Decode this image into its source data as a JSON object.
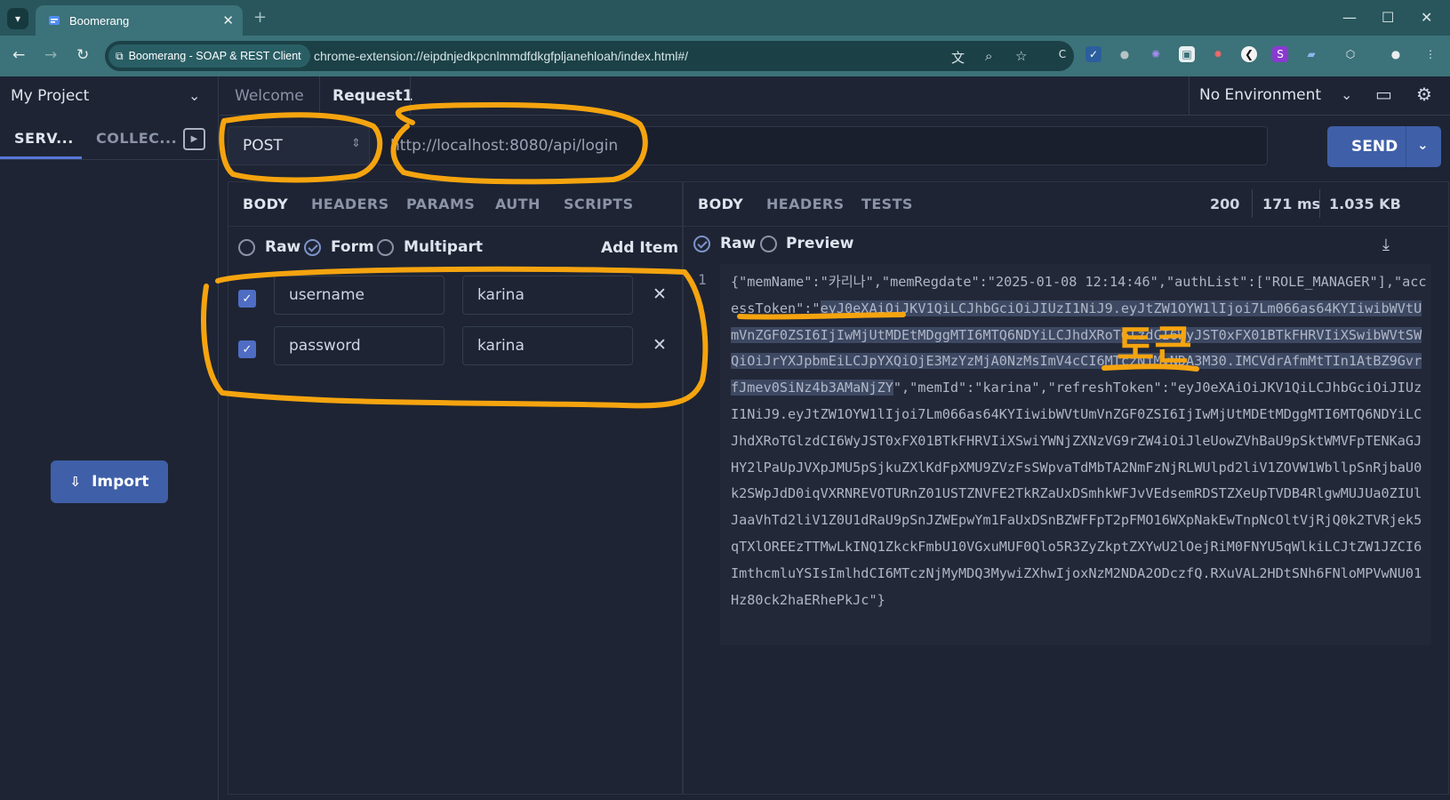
{
  "browser": {
    "tab_title": "Boomerang",
    "site_chip": "Boomerang - SOAP & REST Client",
    "url": "chrome-extension://eipdnjedkpcnlmmdfdkgfpljanehloah/index.html#/"
  },
  "sidebar": {
    "project": "My Project",
    "tabs": [
      "SERV...",
      "COLLEC..."
    ],
    "import_label": "Import"
  },
  "request_tabs": [
    "Welcome",
    "Request1"
  ],
  "environment": "No Environment",
  "request": {
    "method": "POST",
    "url": "http://localhost:8080/api/login",
    "send_label": "SEND",
    "tabs": [
      "BODY",
      "HEADERS",
      "PARAMS",
      "AUTH",
      "SCRIPTS"
    ],
    "body_modes": [
      "Raw",
      "Form",
      "Multipart"
    ],
    "selected_mode": "Form",
    "add_item_label": "Add Item",
    "form_rows": [
      {
        "checked": true,
        "key": "username",
        "value": "karina"
      },
      {
        "checked": true,
        "key": "password",
        "value": "karina"
      }
    ]
  },
  "response": {
    "tabs": [
      "BODY",
      "HEADERS",
      "TESTS"
    ],
    "view_modes": [
      "Raw",
      "Preview"
    ],
    "status": "200",
    "time": "171 ms",
    "size": "1.035 KB",
    "line_number": "1",
    "body_pre": "{\"memName\":\"카리나\",\"memRegdate\":\"2025-01-08 12:14:46\",\"authList\":[\"ROLE_MANAGER\"],\"accessToken\":\"",
    "body_selected": "eyJ0eXAiOiJKV1QiLCJhbGciOiJIUzI1NiJ9.eyJtZW1OYW1lIjoi7Lm066as64KYIiwibWVtUmVnZGF0ZSI6IjIwMjUtMDEtMDggMTI6MTQ6NDYiLCJhdXRoTGlzdCI6WyJST0xFX01BTkFHRVIiXSwibWVtSWQiOiJrYXJpbmEiLCJpYXQiOjE3MzYzMjA0NzMsImV4cCI6MTczNjMyNDA3M30.IMCVdrAfmMtTIn1AtBZ9GvrfJmev0SiNz4b3AMaNjZY",
    "body_post": "\",\"memId\":\"karina\",\"refreshToken\":\"eyJ0eXAiOiJKV1QiLCJhbGciOiJIUzI1NiJ9.eyJtZW1OYW1lIjoi7Lm066as64KYIiwibWVtUmVnZGF0ZSI6IjIwMjUtMDEtMDggMTI6MTQ6NDYiLCJhdXRoTGlzdCI6WyJST0xFX01BTkFHRVIiXSwiYWNjZXNzVG9rZW4iOiJleUowZVhBaU9pSktWMVFpTENKaGJHY2lPaUpJVXpJMU5pSjkuZXlKdFpXMU9ZVzFsSWpvaTdMbTA2NmFzNjRLWUlpd2liV1ZOVW1WbllpSnRjbaU0k2SWpJdD0iqVXRNREVOTURnZ01USTZNVFE2TkRZaUxDSmhkWFJvVEdsemRDSTZXeUpTVDB4RlgwMUJUa0ZIUlJaaVhTd2liV1Z0U1dRaU9pSnJZWEpwYm1FaUxDSnBZWFFpT2pFMO16WXpNakEwTnpNcOltVjRjQ0k2TVRjek5qTXlOREEzTTMwLkINQ1ZkckFmbU10VGxuMUF0Qlo5R3ZyZkptZXYwU2lOejRiM0FNYU5qWlkiLCJtZW1JZCI6ImthcmluYSIsImlhdCI6MTczNjMyMDQ3MywiZXhwIjoxNzM2NDA2ODczfQ.RXuVAL2HDtSNh6FNloMPVwNU01Hz80ck2haERhePkJc\"}"
  },
  "annotation": {
    "handwritten_label": "토큰",
    "color": "#f5a40f"
  },
  "colors": {
    "accent": "#3f5fa8",
    "checkbox": "#4f6dc5",
    "chrome_tab": "#3c7279",
    "chrome_strip": "#28565c"
  }
}
